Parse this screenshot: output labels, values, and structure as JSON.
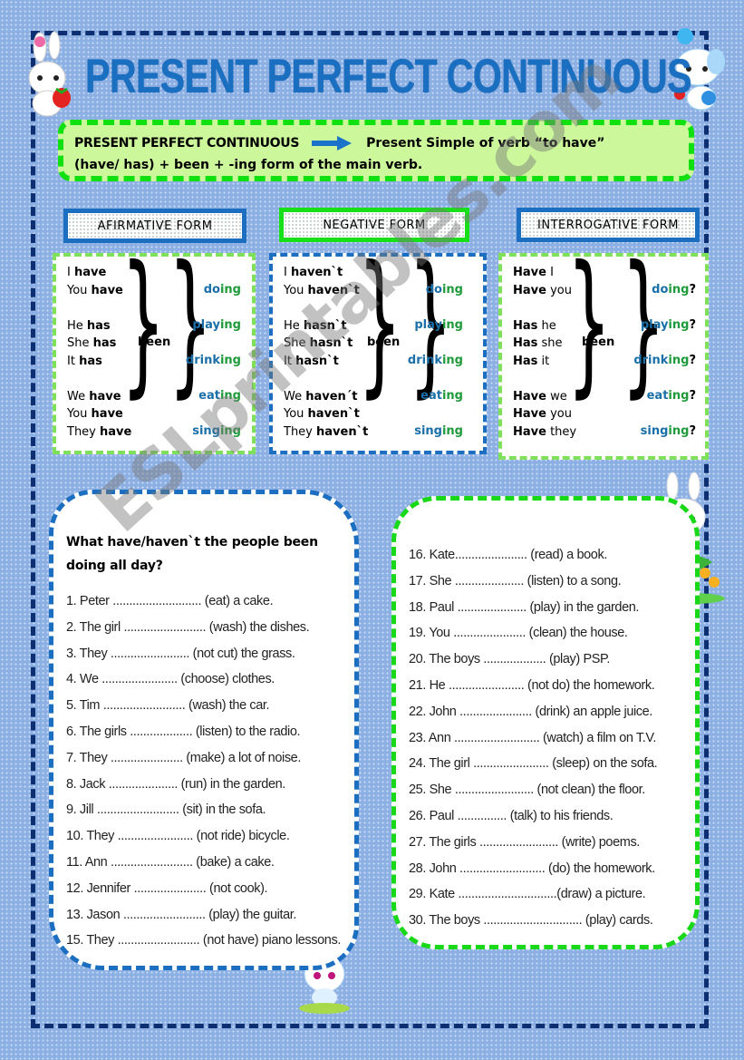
{
  "title": "PRESENT PERFECT CONTINUOUS",
  "definition": {
    "label": "PRESENT PERFECT CONTINUOUS",
    "rule_head": "Present Simple of verb “to have”",
    "rule_tail": "(have/ has) + been + -ing form of the main verb."
  },
  "forms": [
    {
      "heading": "AFIRMATIVE FORM",
      "subjects": [
        {
          "pre": "I ",
          "bold": "have",
          "post": ""
        },
        {
          "pre": "You ",
          "bold": "have",
          "post": ""
        },
        {
          "pre": "He ",
          "bold": "has",
          "post": ""
        },
        {
          "pre": "She ",
          "bold": "has",
          "post": ""
        },
        {
          "pre": "It ",
          "bold": "has",
          "post": ""
        },
        {
          "pre": "We ",
          "bold": "have",
          "post": ""
        },
        {
          "pre": "You ",
          "bold": "have",
          "post": ""
        },
        {
          "pre": "They ",
          "bold": "have",
          "post": ""
        }
      ],
      "been": "been",
      "verbs": [
        {
          "stem": "do",
          "ing": "ing",
          "q": ""
        },
        {
          "stem": "play",
          "ing": "ing",
          "q": ""
        },
        {
          "stem": "drink",
          "ing": "ing",
          "q": ""
        },
        {
          "stem": "eat",
          "ing": "ing",
          "q": ""
        },
        {
          "stem": "sing",
          "ing": "ing",
          "q": ""
        }
      ]
    },
    {
      "heading": "NEGATIVE FORM",
      "subjects": [
        {
          "pre": "I ",
          "bold": "haven`t",
          "post": ""
        },
        {
          "pre": "You ",
          "bold": "haven`t",
          "post": ""
        },
        {
          "pre": "He ",
          "bold": "hasn`t",
          "post": ""
        },
        {
          "pre": "She ",
          "bold": "hasn`t",
          "post": ""
        },
        {
          "pre": "It ",
          "bold": "hasn`t",
          "post": ""
        },
        {
          "pre": "We ",
          "bold": "haven´t",
          "post": ""
        },
        {
          "pre": "You ",
          "bold": "haven`t",
          "post": ""
        },
        {
          "pre": "They ",
          "bold": "haven`t",
          "post": ""
        }
      ],
      "been": "been",
      "verbs": [
        {
          "stem": "do",
          "ing": "ing",
          "q": ""
        },
        {
          "stem": "play",
          "ing": "ing",
          "q": ""
        },
        {
          "stem": "drink",
          "ing": "ing",
          "q": ""
        },
        {
          "stem": "eat",
          "ing": "ing",
          "q": ""
        },
        {
          "stem": "sing",
          "ing": "ing",
          "q": ""
        }
      ]
    },
    {
      "heading": "INTERROGATIVE FORM",
      "subjects": [
        {
          "pre": "",
          "bold": "Have",
          "post": " I"
        },
        {
          "pre": "",
          "bold": "Have",
          "post": " you"
        },
        {
          "pre": "",
          "bold": "Has",
          "post": " he"
        },
        {
          "pre": "",
          "bold": "Has",
          "post": " she"
        },
        {
          "pre": "",
          "bold": "Has",
          "post": " it"
        },
        {
          "pre": "",
          "bold": "Have",
          "post": " we"
        },
        {
          "pre": "",
          "bold": "Have",
          "post": " you"
        },
        {
          "pre": "",
          "bold": "Have",
          "post": " they"
        }
      ],
      "been": "been",
      "verbs": [
        {
          "stem": "do",
          "ing": "ing",
          "q": "?"
        },
        {
          "stem": "play",
          "ing": "ing",
          "q": "?"
        },
        {
          "stem": "drink",
          "ing": "ing",
          "q": "?"
        },
        {
          "stem": "eat",
          "ing": "ing",
          "q": "?"
        },
        {
          "stem": "sing",
          "ing": "ing",
          "q": "?"
        }
      ]
    }
  ],
  "exercise": {
    "question": "What have/haven`t the people been doing all day?",
    "left_items": [
      "1.  Peter ........................... (eat) a cake.",
      " 2. The girl ......................... (wash) the dishes.",
      " 3. They ........................ (not cut) the grass.",
      "  4. We ....................... (choose) clothes.",
      " 5. Tim ......................... (wash) the car.",
      " 6. The girls ................... (listen) to the radio.",
      " 7. They ...................... (make) a lot of noise.",
      " 8. Jack ..................... (run) in the garden.",
      " 9. Jill ......................... (sit) in the sofa.",
      "10. They ....................... (not ride) bicycle.",
      "11. Ann ......................... (bake) a cake.",
      "12. Jennifer ...................... (not cook).",
      "13. Jason .........................  (play) the guitar.",
      "15. They ......................... (not have) piano lessons."
    ],
    "right_items": [
      "16. Kate...................... (read) a book.",
      "17. She ..................... (listen) to a song.",
      "18. Paul ..................... (play)  in the garden.",
      "19. You ...................... (clean)  the house.",
      "20. The boys ................... (play) PSP.",
      "21. He ....................... (not do) the homework.",
      "22. John ...................... (drink) an apple juice.",
      "23.  Ann  ..........................  (watch)  a  film  on T.V.",
      "24. The girl ....................... (sleep) on the sofa.",
      "25. She ........................ (not clean) the floor.",
      "26. Paul ............... (talk) to his friends.",
      "27. The girls ........................ (write) poems.",
      "28. John .......................... (do) the homework.",
      "29. Kate ..............................(draw) a picture.",
      "30. The boys .............................. (play) cards."
    ]
  },
  "watermark": "ESLprintables.com",
  "colors": {
    "background": "#8db0e4",
    "frame": "#0e2e72",
    "title": "#1a6fc1",
    "definition_bg": "#ccf79b",
    "green_border": "#18e018",
    "blue_border": "#1c6fc0",
    "verb_stem": "#1a6fa8",
    "verb_ing": "#1f9a3a"
  }
}
